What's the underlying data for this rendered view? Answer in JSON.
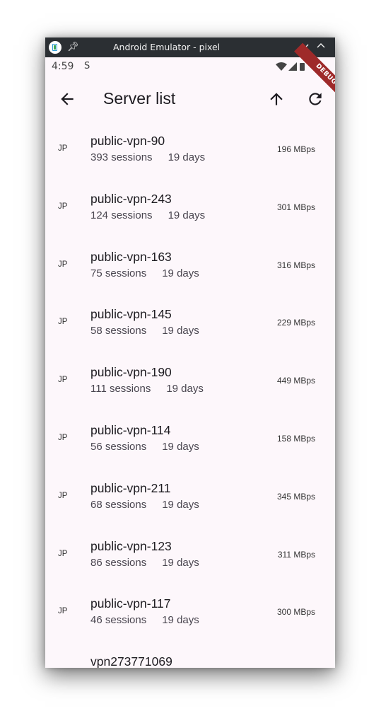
{
  "window": {
    "title": "Android Emulator - pixel"
  },
  "statusbar": {
    "time": "4:59",
    "extra_icon": "S"
  },
  "debug_banner": "DEBUG",
  "appbar": {
    "title": "Server list"
  },
  "servers": [
    {
      "country": "JP",
      "name": "public-vpn-90",
      "sessions": "393 sessions",
      "uptime": "19 days",
      "speed": "196 MBps"
    },
    {
      "country": "JP",
      "name": "public-vpn-243",
      "sessions": "124 sessions",
      "uptime": "19 days",
      "speed": "301 MBps"
    },
    {
      "country": "JP",
      "name": "public-vpn-163",
      "sessions": "75 sessions",
      "uptime": "19 days",
      "speed": "316 MBps"
    },
    {
      "country": "JP",
      "name": "public-vpn-145",
      "sessions": "58 sessions",
      "uptime": "19 days",
      "speed": "229 MBps"
    },
    {
      "country": "JP",
      "name": "public-vpn-190",
      "sessions": "111 sessions",
      "uptime": "19 days",
      "speed": "449 MBps"
    },
    {
      "country": "JP",
      "name": "public-vpn-114",
      "sessions": "56 sessions",
      "uptime": "19 days",
      "speed": "158 MBps"
    },
    {
      "country": "JP",
      "name": "public-vpn-211",
      "sessions": "68 sessions",
      "uptime": "19 days",
      "speed": "345 MBps"
    },
    {
      "country": "JP",
      "name": "public-vpn-123",
      "sessions": "86 sessions",
      "uptime": "19 days",
      "speed": "311 MBps"
    },
    {
      "country": "JP",
      "name": "public-vpn-117",
      "sessions": "46 sessions",
      "uptime": "19 days",
      "speed": "300 MBps"
    },
    {
      "country": "",
      "name": "vpn273771069",
      "sessions": "",
      "uptime": "",
      "speed": ""
    }
  ],
  "icons": {
    "app": "android-emulator-icon",
    "pin": "pin-icon",
    "minimize": "chevron-down-icon",
    "maximize": "chevron-up-icon",
    "status": [
      "wifi-icon",
      "signal-icon",
      "battery-icon"
    ],
    "back": "arrow-left-icon",
    "sort": "arrow-up-icon",
    "refresh": "refresh-icon"
  },
  "colors": {
    "titlebar": "#2b2f33",
    "background": "#fdf7fb",
    "debug_ribbon": "#9e2a2a"
  }
}
